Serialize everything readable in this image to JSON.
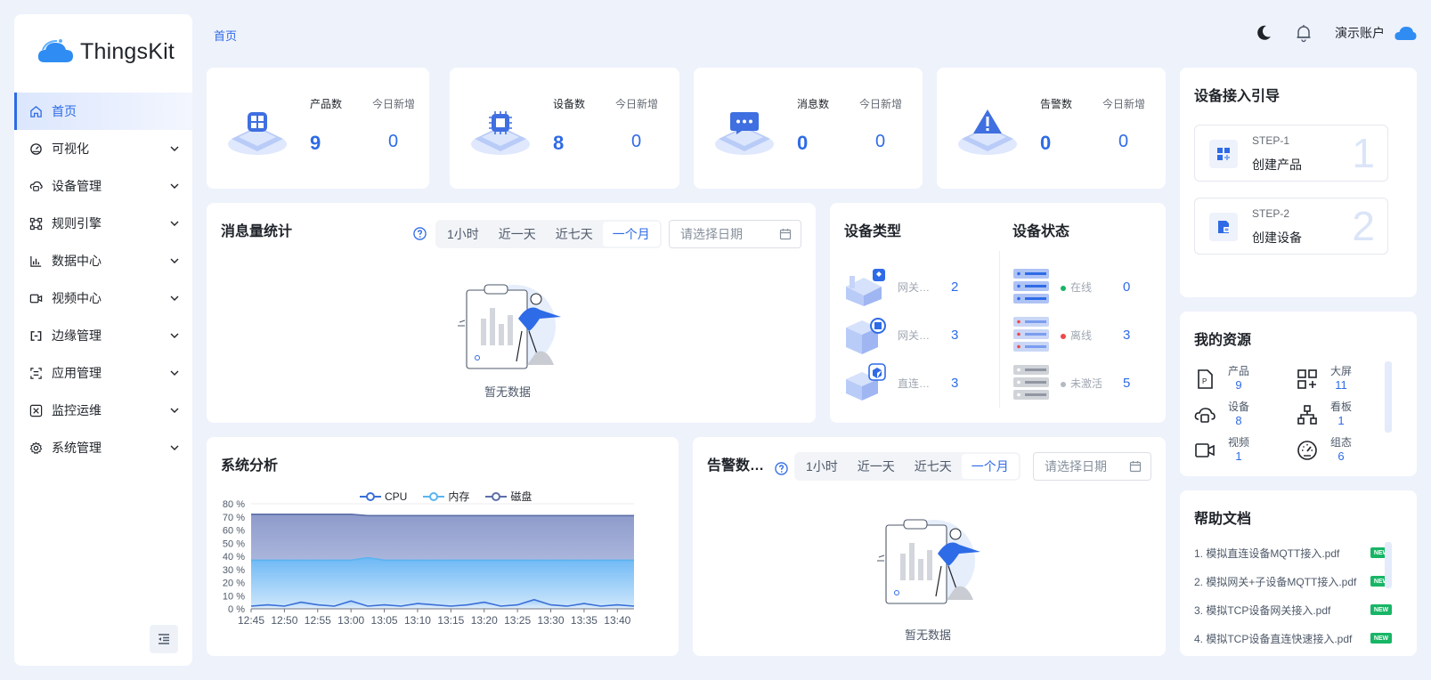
{
  "app": {
    "logo_text": "ThingsKit"
  },
  "breadcrumb": "首页",
  "header": {
    "account": "演示账户"
  },
  "sidebar": {
    "items": [
      {
        "label": "首页",
        "icon": "home-icon",
        "active": true
      },
      {
        "label": "可视化",
        "icon": "dashboard-icon"
      },
      {
        "label": "设备管理",
        "icon": "device-icon"
      },
      {
        "label": "规则引擎",
        "icon": "rule-icon"
      },
      {
        "label": "数据中心",
        "icon": "chart-icon"
      },
      {
        "label": "视频中心",
        "icon": "video-icon"
      },
      {
        "label": "边缘管理",
        "icon": "edge-icon"
      },
      {
        "label": "应用管理",
        "icon": "app-icon"
      },
      {
        "label": "监控运维",
        "icon": "monitor-icon"
      },
      {
        "label": "系统管理",
        "icon": "gear-icon"
      }
    ]
  },
  "stats": [
    {
      "label": "产品数",
      "value": "9",
      "today_label": "今日新增",
      "today": "0",
      "icon": "product-icon"
    },
    {
      "label": "设备数",
      "value": "8",
      "today_label": "今日新增",
      "today": "0",
      "icon": "chip-icon"
    },
    {
      "label": "消息数",
      "value": "0",
      "today_label": "今日新增",
      "today": "0",
      "icon": "message-icon"
    },
    {
      "label": "告警数",
      "value": "0",
      "today_label": "今日新增",
      "today": "0",
      "icon": "alert-icon"
    }
  ],
  "message_stats": {
    "title": "消息量统计",
    "ranges": [
      "1小时",
      "近一天",
      "近七天",
      "一个月"
    ],
    "selected": "一个月",
    "date_placeholder": "请选择日期",
    "empty": "暂无数据"
  },
  "device_types": {
    "title": "设备类型",
    "rows": [
      {
        "name": "网关…",
        "count": "2"
      },
      {
        "name": "网关…",
        "count": "3"
      },
      {
        "name": "直连…",
        "count": "3"
      }
    ]
  },
  "device_status": {
    "title": "设备状态",
    "rows": [
      {
        "name": "在线",
        "count": "0",
        "color": "#18b566"
      },
      {
        "name": "离线",
        "count": "3",
        "color": "#f04848"
      },
      {
        "name": "未激活",
        "count": "5",
        "color": "#b4b9c2"
      }
    ]
  },
  "guide": {
    "title": "设备接入引导",
    "steps": [
      {
        "step": "STEP-1",
        "name": "创建产品",
        "num": "1"
      },
      {
        "step": "STEP-2",
        "name": "创建设备",
        "num": "2"
      }
    ]
  },
  "resources": {
    "title": "我的资源",
    "items": [
      {
        "name": "产品",
        "value": "9",
        "icon": "product-file-icon"
      },
      {
        "name": "大屏",
        "value": "11",
        "icon": "grid-plus-icon"
      },
      {
        "name": "设备",
        "value": "8",
        "icon": "device-icon"
      },
      {
        "name": "看板",
        "value": "1",
        "icon": "org-chart-icon"
      },
      {
        "name": "视频",
        "value": "1",
        "icon": "video-icon"
      },
      {
        "name": "组态",
        "value": "6",
        "icon": "gauge-icon"
      }
    ]
  },
  "help": {
    "title": "帮助文档",
    "badge": "NEW",
    "docs": [
      "1. 模拟直连设备MQTT接入.pdf",
      "2. 模拟网关+子设备MQTT接入.pdf",
      "3. 模拟TCP设备网关接入.pdf",
      "4. 模拟TCP设备直连快速接入.pdf"
    ]
  },
  "alarm_stats": {
    "title": "告警数…",
    "ranges": [
      "1小时",
      "近一天",
      "近七天",
      "一个月"
    ],
    "selected": "一个月",
    "date_placeholder": "请选择日期",
    "empty": "暂无数据"
  },
  "chart_data": {
    "type": "area",
    "title": "系统分析",
    "legend": [
      "CPU",
      "内存",
      "磁盘"
    ],
    "legend_position": "top-center",
    "x": [
      "12:45",
      "12:47",
      "12:50",
      "12:52",
      "12:55",
      "12:57",
      "13:00",
      "13:02",
      "13:05",
      "13:07",
      "13:10",
      "13:12",
      "13:15",
      "13:17",
      "13:20",
      "13:22",
      "13:25",
      "13:27",
      "13:30",
      "13:32",
      "13:35",
      "13:37",
      "13:40",
      "13:42"
    ],
    "x_ticks": [
      "12:45",
      "12:50",
      "12:55",
      "13:00",
      "13:05",
      "13:10",
      "13:15",
      "13:20",
      "13:25",
      "13:30",
      "13:35",
      "13:40"
    ],
    "y_ticks": [
      "0 %",
      "10 %",
      "20 %",
      "30 %",
      "40 %",
      "50 %",
      "60 %",
      "70 %",
      "80 %"
    ],
    "ylim": [
      0,
      80
    ],
    "series": [
      {
        "name": "磁盘",
        "color": "#5b6ea8",
        "values": [
          72,
          72,
          72,
          72,
          72,
          72,
          72,
          71,
          71,
          71,
          71,
          71,
          71,
          71,
          71,
          71,
          71,
          71,
          71,
          71,
          71,
          71,
          71,
          71
        ]
      },
      {
        "name": "内存",
        "color": "#5ab4f0",
        "values": [
          37,
          37,
          37,
          37,
          37,
          37,
          37,
          39,
          37,
          37,
          37,
          37,
          37,
          37,
          37,
          37,
          37,
          37,
          37,
          37,
          37,
          37,
          37,
          37
        ]
      },
      {
        "name": "CPU",
        "color": "#3a6fd8",
        "values": [
          2,
          3,
          2,
          5,
          3,
          2,
          6,
          2,
          3,
          2,
          4,
          3,
          2,
          3,
          5,
          2,
          3,
          7,
          3,
          2,
          4,
          2,
          3,
          2
        ]
      }
    ]
  }
}
